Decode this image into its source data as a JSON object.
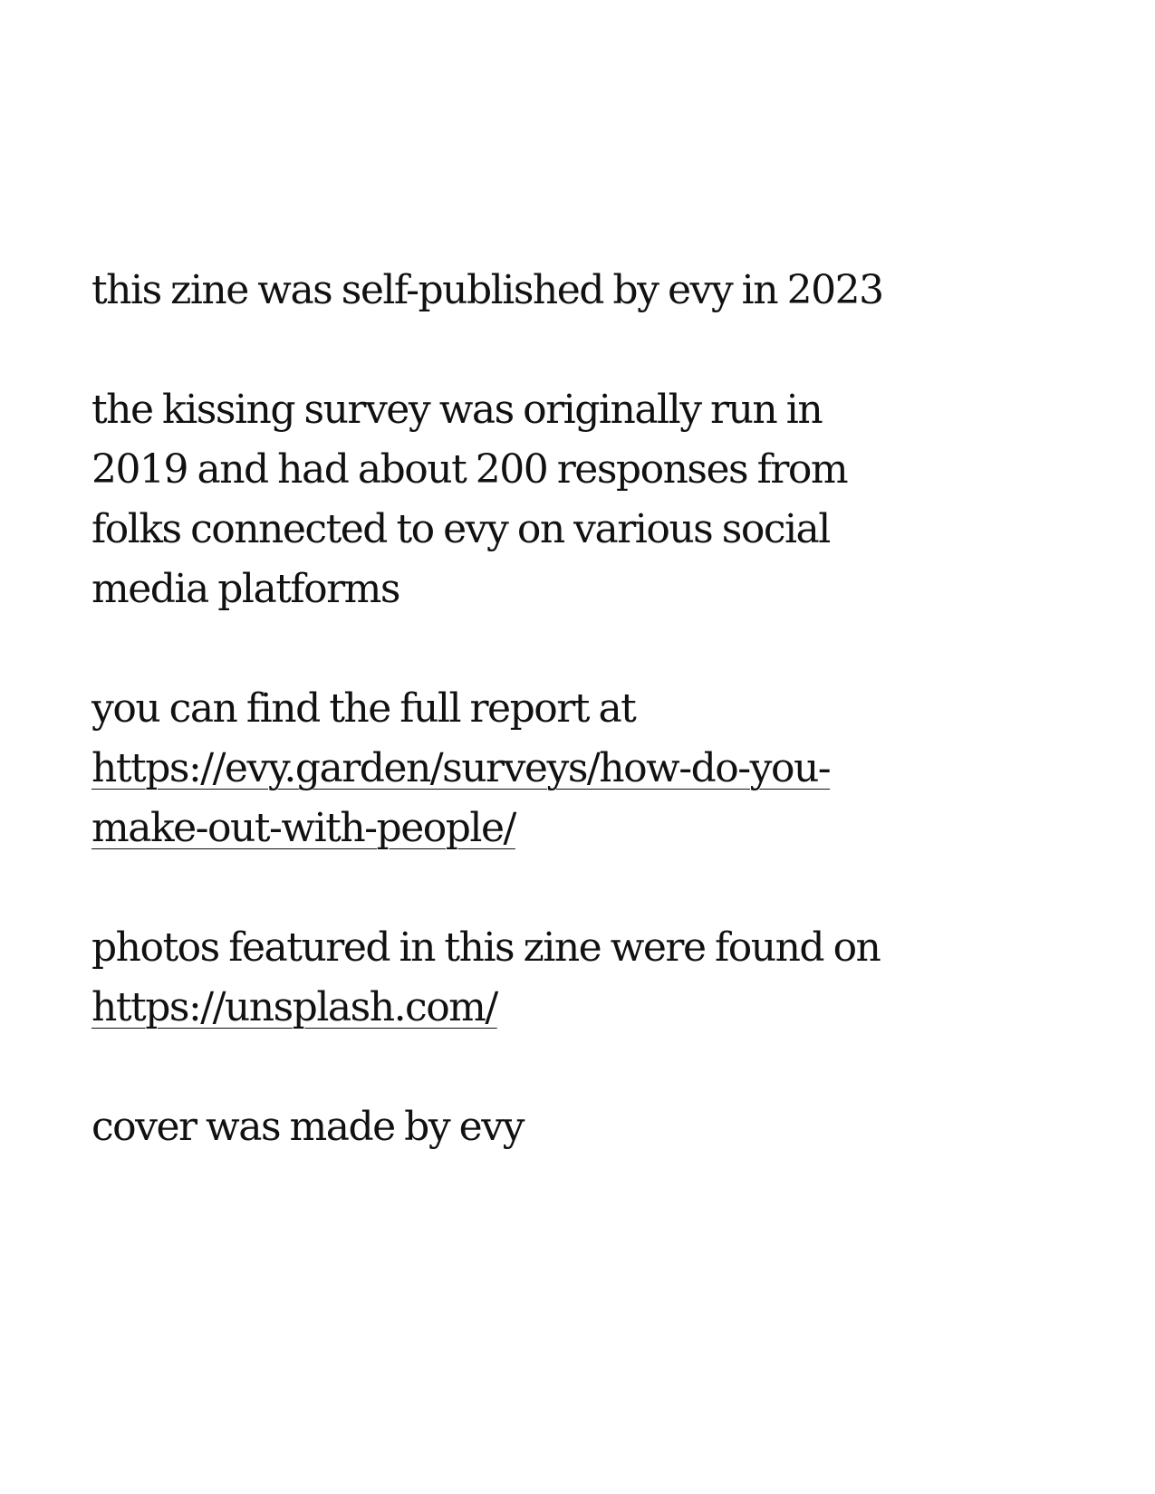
{
  "colophon": {
    "publication_line": "this zine was self-published by evy in 2023",
    "survey_lines": [
      "the kissing survey was originally run in",
      "2019 and had about 200 responses from",
      "folks connected to evy on various social",
      "media platforms"
    ],
    "report_intro": "you can find the full report at",
    "report_link_lines": [
      "https://evy.garden/surveys/how-do-you-",
      "make-out-with-people/"
    ],
    "photos_intro": "photos featured in this zine were found on",
    "photos_link": "https://unsplash.com/",
    "cover_credit": "cover was made by evy"
  }
}
